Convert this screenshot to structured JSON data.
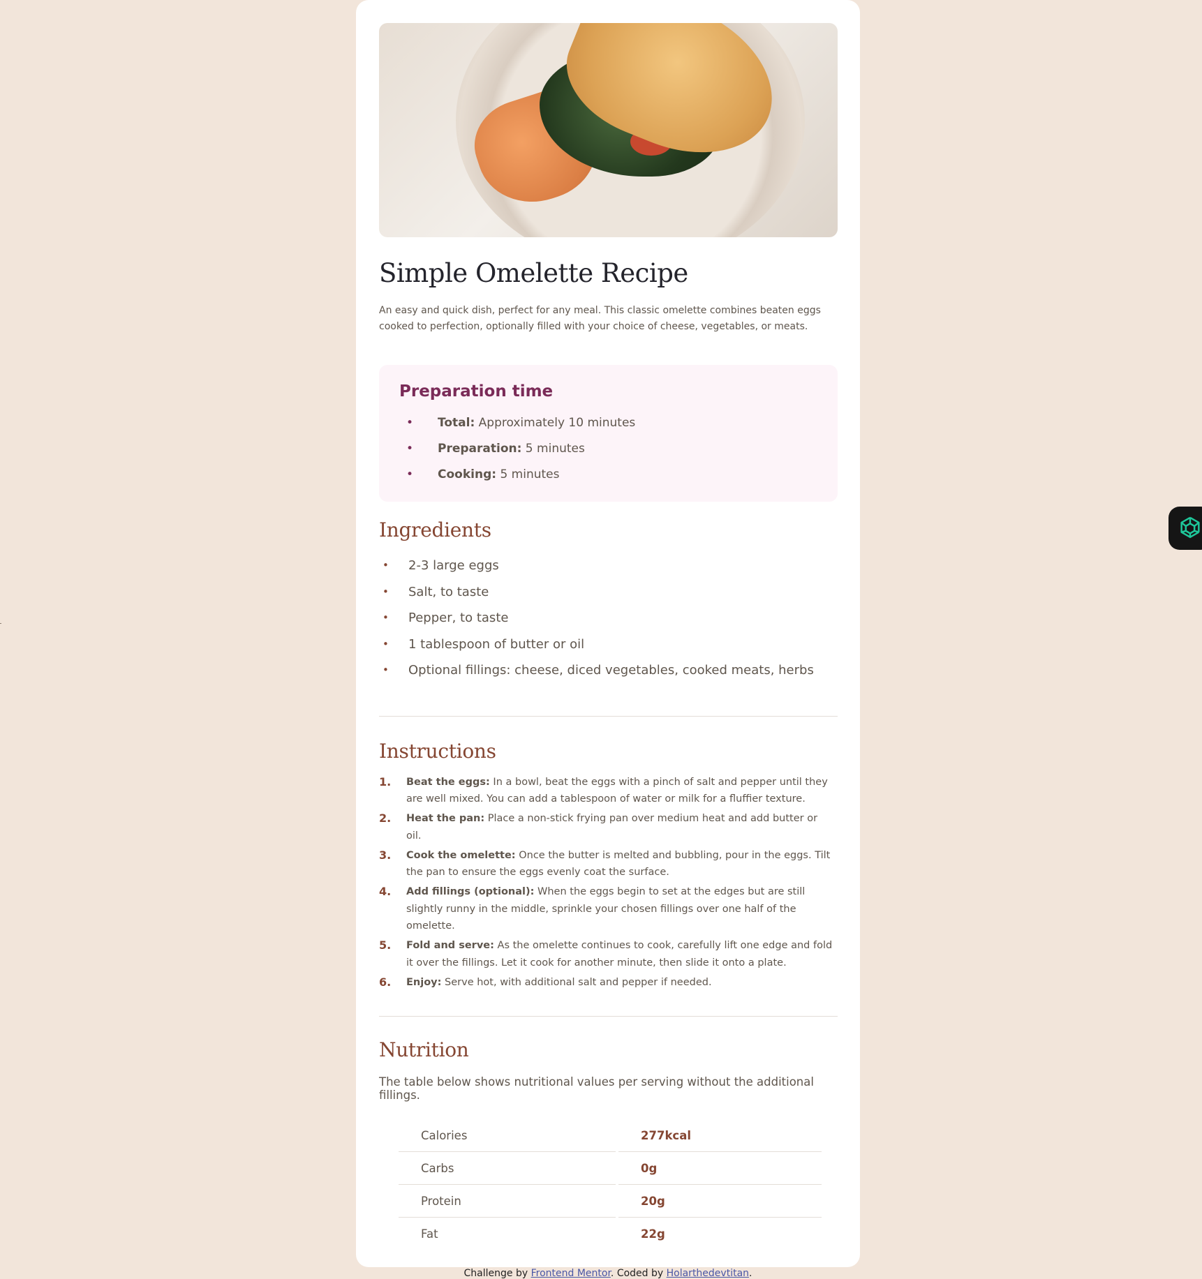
{
  "recipe": {
    "title": "Simple Omelette Recipe",
    "intro": "An easy and quick dish, perfect for any meal. This classic omelette combines beaten eggs cooked to perfection, optionally filled with your choice of cheese, vegetables, or meats."
  },
  "prep": {
    "heading": "Preparation time",
    "items": [
      {
        "label": "Total:",
        "value": " Approximately 10 minutes"
      },
      {
        "label": "Preparation:",
        "value": " 5 minutes"
      },
      {
        "label": "Cooking:",
        "value": " 5 minutes"
      }
    ]
  },
  "ingredients": {
    "heading": "Ingredients",
    "items": [
      "2-3 large eggs",
      "Salt, to taste",
      "Pepper, to taste",
      "1 tablespoon of butter or oil",
      "Optional fillings: cheese, diced vegetables, cooked meats, herbs"
    ]
  },
  "instructions": {
    "heading": "Instructions",
    "items": [
      {
        "num": "1.",
        "label": "Beat the eggs:",
        "text": " In a bowl, beat the eggs with a pinch of salt and pepper until they are well mixed. You can add a tablespoon of water or milk for a fluffier texture."
      },
      {
        "num": "2.",
        "label": "Heat the pan:",
        "text": " Place a non-stick frying pan over medium heat and add butter or oil."
      },
      {
        "num": "3.",
        "label": "Cook the omelette:",
        "text": " Once the butter is melted and bubbling, pour in the eggs. Tilt the pan to ensure the eggs evenly coat the surface."
      },
      {
        "num": "4.",
        "label": "Add fillings (optional):",
        "text": " When the eggs begin to set at the edges but are still slightly runny in the middle, sprinkle your chosen fillings over one half of the omelette."
      },
      {
        "num": "5.",
        "label": "Fold and serve:",
        "text": " As the omelette continues to cook, carefully lift one edge and fold it over the fillings. Let it cook for another minute, then slide it onto a plate."
      },
      {
        "num": "6.",
        "label": "Enjoy:",
        "text": " Serve hot, with additional salt and pepper if needed."
      }
    ]
  },
  "nutrition": {
    "heading": "Nutrition",
    "text": "The table below shows nutritional values per serving without the additional fillings.",
    "rows": [
      {
        "name": "Calories",
        "value": "277kcal"
      },
      {
        "name": "Carbs",
        "value": "0g"
      },
      {
        "name": "Protein",
        "value": "20g"
      },
      {
        "name": "Fat",
        "value": "22g"
      }
    ]
  },
  "footer": {
    "prefix": "Challenge by ",
    "link1": "Frontend Mentor",
    "middle": ". Coded by ",
    "link2": "Holarthedevtitan",
    "suffix": "."
  },
  "fab": {
    "icon": "openai-icon"
  },
  "colors": {
    "page_bg": "#f2e5da",
    "card_bg": "#ffffff",
    "heading_brown": "#854632",
    "prep_bg": "#fdf4f9",
    "prep_heading": "#7a2b58",
    "body_text": "#5f564d"
  }
}
